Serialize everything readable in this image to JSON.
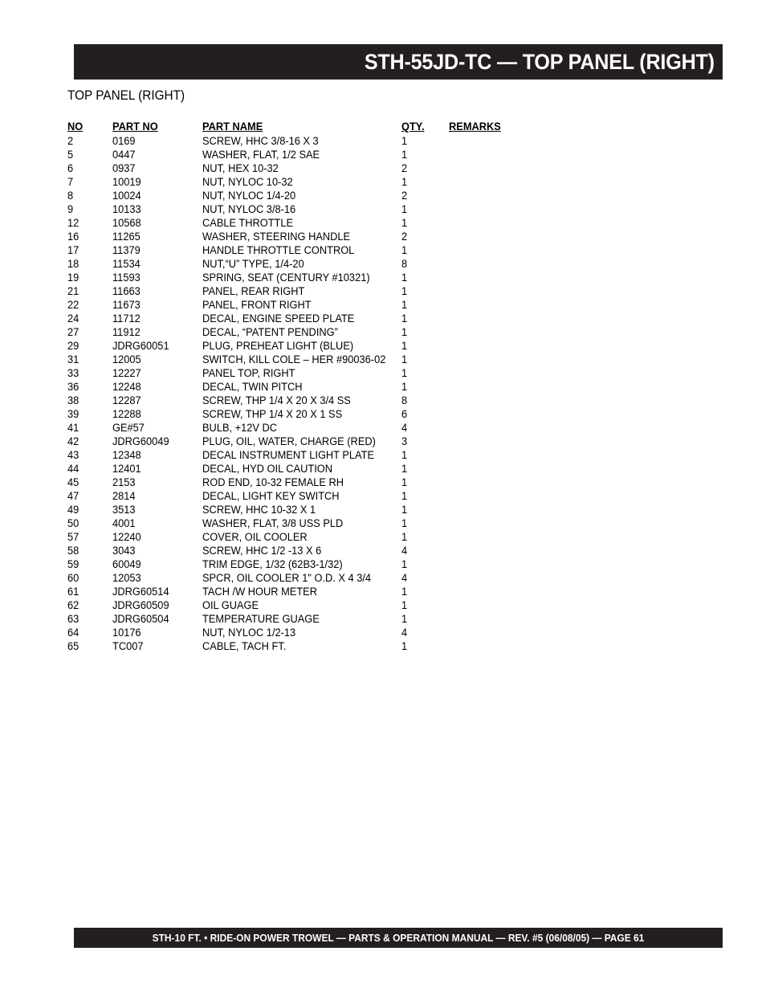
{
  "header": {
    "title": "STH-55JD-TC — TOP PANEL (RIGHT)",
    "bar_color": "#231f20"
  },
  "subtitle": "TOP PANEL (RIGHT)",
  "table": {
    "columns": {
      "no": "NO",
      "part_no": "PART NO",
      "part_name": "PART NAME",
      "qty": "QTY.",
      "remarks": "REMARKS"
    },
    "rows": [
      {
        "no": "2",
        "part_no": "0169",
        "part_name": "SCREW, HHC 3/8-16 X 3",
        "qty": "1",
        "remarks": ""
      },
      {
        "no": "5",
        "part_no": "0447",
        "part_name": "WASHER, FLAT, 1/2 SAE",
        "qty": "1",
        "remarks": ""
      },
      {
        "no": "6",
        "part_no": "0937",
        "part_name": "NUT, HEX 10-32",
        "qty": "2",
        "remarks": ""
      },
      {
        "no": "7",
        "part_no": "10019",
        "part_name": "NUT, NYLOC 10-32",
        "qty": "1",
        "remarks": ""
      },
      {
        "no": "8",
        "part_no": "10024",
        "part_name": "NUT, NYLOC 1/4-20",
        "qty": "2",
        "remarks": ""
      },
      {
        "no": "9",
        "part_no": "10133",
        "part_name": "NUT, NYLOC 3/8-16",
        "qty": "1",
        "remarks": ""
      },
      {
        "no": "12",
        "part_no": "10568",
        "part_name": "CABLE THROTTLE",
        "qty": "1",
        "remarks": ""
      },
      {
        "no": "16",
        "part_no": "11265",
        "part_name": "WASHER, STEERING HANDLE",
        "qty": "2",
        "remarks": ""
      },
      {
        "no": "17",
        "part_no": "11379",
        "part_name": "HANDLE THROTTLE CONTROL",
        "qty": "1",
        "remarks": ""
      },
      {
        "no": "18",
        "part_no": "11534",
        "part_name": "NUT,“U” TYPE, 1/4-20",
        "qty": "8",
        "remarks": ""
      },
      {
        "no": "19",
        "part_no": "11593",
        "part_name": "SPRING, SEAT (CENTURY #10321)",
        "qty": "1",
        "remarks": ""
      },
      {
        "no": "21",
        "part_no": "11663",
        "part_name": "PANEL, REAR RIGHT",
        "qty": "1",
        "remarks": ""
      },
      {
        "no": "22",
        "part_no": "11673",
        "part_name": "PANEL, FRONT RIGHT",
        "qty": "1",
        "remarks": ""
      },
      {
        "no": "24",
        "part_no": "11712",
        "part_name": "DECAL, ENGINE SPEED PLATE",
        "qty": "1",
        "remarks": ""
      },
      {
        "no": "27",
        "part_no": "11912",
        "part_name": "DECAL, “PATENT PENDING”",
        "qty": "1",
        "remarks": ""
      },
      {
        "no": "29",
        "part_no": "JDRG60051",
        "part_name": "PLUG, PREHEAT LIGHT (BLUE)",
        "qty": "1",
        "remarks": ""
      },
      {
        "no": "31",
        "part_no": "12005",
        "part_name": "SWITCH, KILL COLE – HER #90036-02",
        "qty": "1",
        "remarks": ""
      },
      {
        "no": "33",
        "part_no": "12227",
        "part_name": "PANEL TOP, RIGHT",
        "qty": "1",
        "remarks": ""
      },
      {
        "no": "36",
        "part_no": "12248",
        "part_name": "DECAL, TWIN PITCH",
        "qty": "1",
        "remarks": ""
      },
      {
        "no": "38",
        "part_no": "12287",
        "part_name": "SCREW, THP 1/4 X 20 X 3/4 SS",
        "qty": "8",
        "remarks": ""
      },
      {
        "no": "39",
        "part_no": "12288",
        "part_name": "SCREW, THP 1/4 X 20 X 1 SS",
        "qty": "6",
        "remarks": ""
      },
      {
        "no": "41",
        "part_no": "GE#57",
        "part_name": "BULB, +12V DC",
        "qty": "4",
        "remarks": ""
      },
      {
        "no": "42",
        "part_no": "JDRG60049",
        "part_name": "PLUG, OIL, WATER, CHARGE (RED)",
        "qty": "3",
        "remarks": ""
      },
      {
        "no": "43",
        "part_no": "12348",
        "part_name": "DECAL INSTRUMENT LIGHT PLATE",
        "qty": "1",
        "remarks": ""
      },
      {
        "no": "44",
        "part_no": "12401",
        "part_name": "DECAL, HYD OIL CAUTION",
        "qty": "1",
        "remarks": ""
      },
      {
        "no": "45",
        "part_no": "2153",
        "part_name": "ROD END, 10-32 FEMALE RH",
        "qty": "1",
        "remarks": ""
      },
      {
        "no": "47",
        "part_no": "2814",
        "part_name": "DECAL, LIGHT KEY SWITCH",
        "qty": "1",
        "remarks": ""
      },
      {
        "no": "49",
        "part_no": "3513",
        "part_name": "SCREW, HHC 10-32 X 1",
        "qty": "1",
        "remarks": ""
      },
      {
        "no": "50",
        "part_no": "4001",
        "part_name": "WASHER, FLAT, 3/8 USS PLD",
        "qty": "1",
        "remarks": ""
      },
      {
        "no": "57",
        "part_no": "12240",
        "part_name": "COVER, OIL COOLER",
        "qty": "1",
        "remarks": ""
      },
      {
        "no": "58",
        "part_no": "3043",
        "part_name": "SCREW, HHC 1/2 -13 X 6",
        "qty": "4",
        "remarks": ""
      },
      {
        "no": "59",
        "part_no": "60049",
        "part_name": "TRIM EDGE, 1/32 (62B3-1/32)",
        "qty": "1",
        "remarks": ""
      },
      {
        "no": "60",
        "part_no": "12053",
        "part_name": "SPCR, OIL COOLER 1\" O.D. X 4 3/4",
        "qty": "4",
        "remarks": ""
      },
      {
        "no": "61",
        "part_no": "JDRG60514",
        "part_name": "TACH /W HOUR METER",
        "qty": "1",
        "remarks": ""
      },
      {
        "no": "62",
        "part_no": "JDRG60509",
        "part_name": "OIL GUAGE",
        "qty": "1",
        "remarks": ""
      },
      {
        "no": "63",
        "part_no": "JDRG60504",
        "part_name": "TEMPERATURE GUAGE",
        "qty": "1",
        "remarks": ""
      },
      {
        "no": "64",
        "part_no": "10176",
        "part_name": "NUT, NYLOC 1/2-13",
        "qty": "4",
        "remarks": ""
      },
      {
        "no": "65",
        "part_no": "TC007",
        "part_name": "CABLE, TACH FT.",
        "qty": "1",
        "remarks": ""
      }
    ]
  },
  "footer": {
    "text": "STH-10 FT. • RIDE-ON POWER TROWEL — PARTS & OPERATION MANUAL — REV.  #5 (06/08/05) — PAGE 61",
    "bar_color": "#231f20"
  }
}
